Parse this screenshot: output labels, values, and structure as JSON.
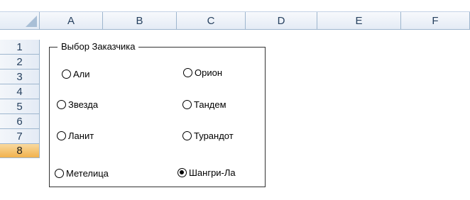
{
  "columns": [
    "A",
    "B",
    "C",
    "D",
    "E",
    "F"
  ],
  "rows": [
    "1",
    "2",
    "3",
    "4",
    "5",
    "6",
    "7",
    "8"
  ],
  "selected_row": "8",
  "groupbox": {
    "title": "Выбор Заказчика",
    "options": [
      {
        "label": "Али",
        "checked": false
      },
      {
        "label": "Орион",
        "checked": false
      },
      {
        "label": "Звезда",
        "checked": false
      },
      {
        "label": "Тандем",
        "checked": false
      },
      {
        "label": "Ланит",
        "checked": false
      },
      {
        "label": "Турандот",
        "checked": false
      },
      {
        "label": "Метелица",
        "checked": false
      },
      {
        "label": "Шангри-Ла",
        "checked": true
      }
    ]
  }
}
